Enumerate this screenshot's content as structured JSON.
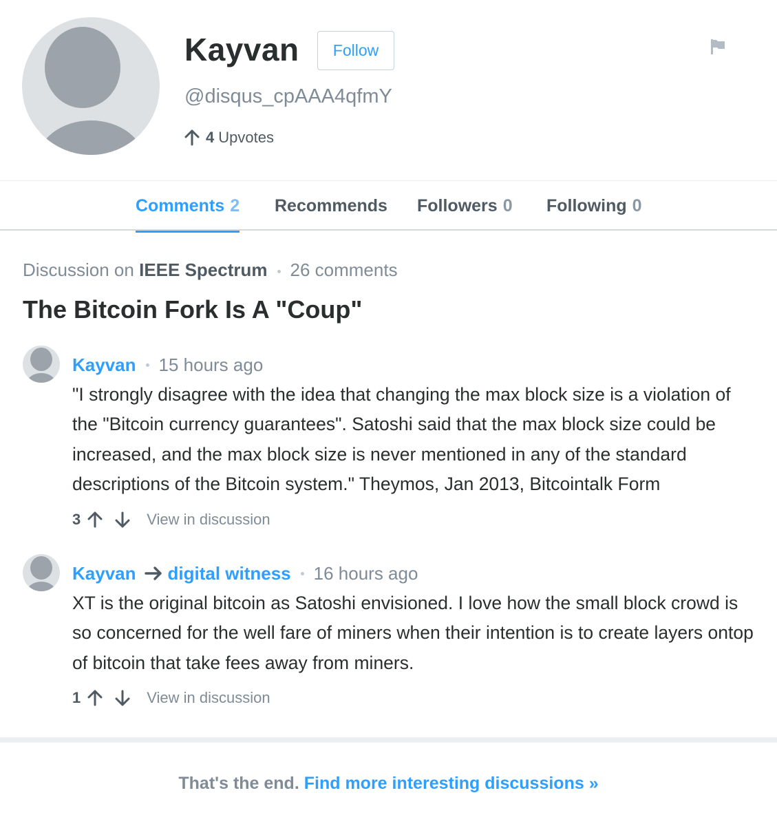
{
  "profile": {
    "name": "Kayvan",
    "follow_label": "Follow",
    "username": "@disqus_cpAAA4qfmY",
    "upvotes_count": "4",
    "upvotes_label": "Upvotes"
  },
  "tabs": [
    {
      "label": "Comments",
      "count": "2",
      "active": true
    },
    {
      "label": "Recommends",
      "count": "",
      "active": false
    },
    {
      "label": "Followers",
      "count": "0",
      "active": false
    },
    {
      "label": "Following",
      "count": "0",
      "active": false
    }
  ],
  "discussion": {
    "prefix": "Discussion on",
    "forum": "IEEE Spectrum",
    "comments_count": "26 comments",
    "title": "The Bitcoin Fork Is A \"Coup\""
  },
  "comments": [
    {
      "author": "Kayvan",
      "reply_to": "",
      "time": "15 hours ago",
      "body": "\"I strongly disagree with the idea that changing the max block size is a violation of the \"Bitcoin currency guarantees\". Satoshi said that the max block size could be increased, and the max block size is never mentioned in any of the standard descriptions of the Bitcoin system.\" Theymos, Jan 2013, Bitcointalk Form",
      "votes": "3",
      "view_label": "View in discussion"
    },
    {
      "author": "Kayvan",
      "reply_to": "digital witness",
      "time": "16 hours ago",
      "body": "XT is the original bitcoin as Satoshi envisioned. I love how the small block crowd is so concerned for the well fare of miners when their intention is to create layers ontop of bitcoin that take fees away from miners.",
      "votes": "1",
      "view_label": "View in discussion"
    }
  ],
  "footer": {
    "end_text": "That's the end.",
    "find_more": "Find more interesting discussions »"
  },
  "colors": {
    "accent": "#2e9fff",
    "avatar_bg": "#dde1e4",
    "avatar_fg": "#9ca3aa",
    "muted_text": "#7f8b96"
  }
}
